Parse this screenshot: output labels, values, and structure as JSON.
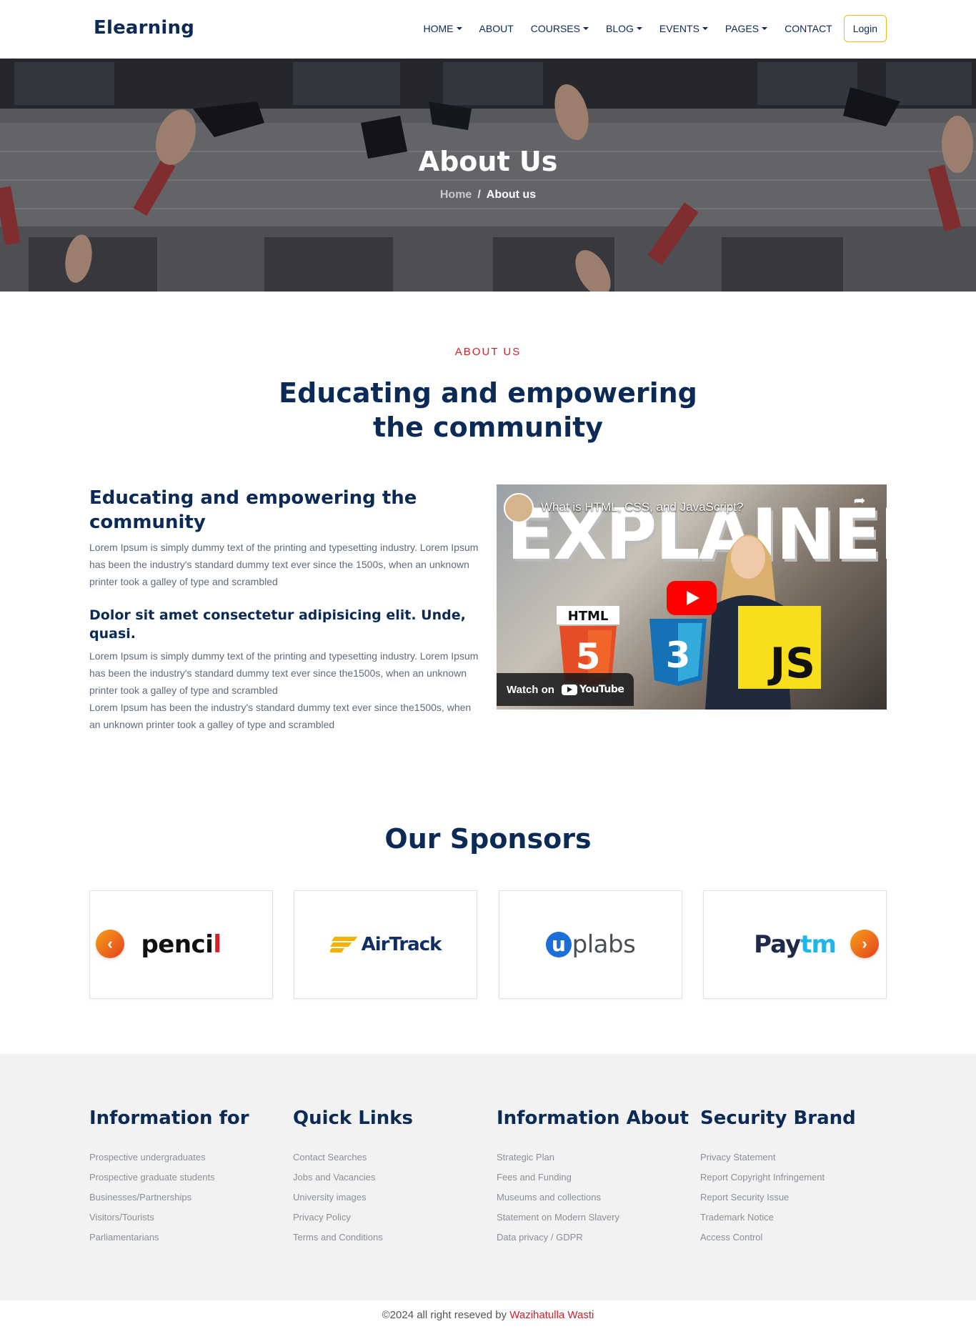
{
  "nav": {
    "brand": "Elearning",
    "items": [
      {
        "label": "HOME",
        "dropdown": true
      },
      {
        "label": "ABOUT",
        "dropdown": false
      },
      {
        "label": "COURSES",
        "dropdown": true
      },
      {
        "label": "BLOG",
        "dropdown": true
      },
      {
        "label": "EVENTS",
        "dropdown": true
      },
      {
        "label": "PAGES",
        "dropdown": true
      },
      {
        "label": "CONTACT",
        "dropdown": false
      }
    ],
    "login": "Login"
  },
  "hero": {
    "title": "About Us",
    "breadcrumb_home": "Home",
    "breadcrumb_sep": "/",
    "breadcrumb_current": "About us"
  },
  "about": {
    "kicker": "ABOUT US",
    "heading": "Educating and empowering the community",
    "sub_heading": "Educating and empowering the community",
    "para1": "Lorem Ipsum is simply dummy text of the printing and typesetting industry. Lorem Ipsum has been the industry's standard dummy text ever since the 1500s, when an unknown printer took a galley of type and scrambled",
    "sub_heading2": "Dolor sit amet consectetur adipisicing elit. Unde, quasi.",
    "para2": "Lorem Ipsum is simply dummy text of the printing and typesetting industry. Lorem Ipsum has been the industry's standard dummy text ever since the1500s, when an unknown printer took a galley of type and scrambled",
    "para3": "Lorem Ipsum has been the industry's standard dummy text ever since the1500s, when an unknown printer took a galley of type and scrambled"
  },
  "video": {
    "title": "What is HTML, CSS, and JavaScript?",
    "overlay_word": "EXPLAINED",
    "share": "Share",
    "watch_on": "Watch on",
    "youtube": "YouTube",
    "html_badge": "HTML",
    "js_badge": "JS"
  },
  "sponsors": {
    "title": "Our Sponsors",
    "logos": [
      {
        "name": "pencil",
        "text_main": "penci",
        "text_end": "l"
      },
      {
        "name": "airtrack",
        "text": "AirTrack"
      },
      {
        "name": "uplabs",
        "circle": "u",
        "text": "plabs"
      },
      {
        "name": "paytm",
        "pay": "Pay",
        "tm": "tm"
      }
    ],
    "prev": "‹",
    "next": "›"
  },
  "footer": {
    "columns": [
      {
        "title": "Information for",
        "links": [
          "Prospective undergraduates",
          "Prospective graduate students",
          "Businesses/Partnerships",
          "Visitors/Tourists",
          "Parliamentarians"
        ]
      },
      {
        "title": "Quick Links",
        "links": [
          "Contact Searches",
          "Jobs and Vacancies",
          "University images",
          "Privacy Policy",
          "Terms and Conditions"
        ]
      },
      {
        "title": "Information About",
        "links": [
          "Strategic Plan",
          "Fees and Funding",
          "Museums and collections",
          "Statement on Modern Slavery",
          "Data privacy / GDPR"
        ]
      },
      {
        "title": "Security Brand",
        "links": [
          "Privacy Statement",
          "Report Copyright Infringement",
          "Report Security Issue",
          "Trademark Notice",
          "Access Control"
        ]
      }
    ],
    "copyright_prefix": "©2024 all right reseved by ",
    "copyright_author": "Wazihatulla Wasti"
  },
  "colors": {
    "navy": "#0b2a55",
    "accent_red": "#d11f2b",
    "login_border": "#f3b619",
    "footer_bg": "#f2f2f2"
  }
}
